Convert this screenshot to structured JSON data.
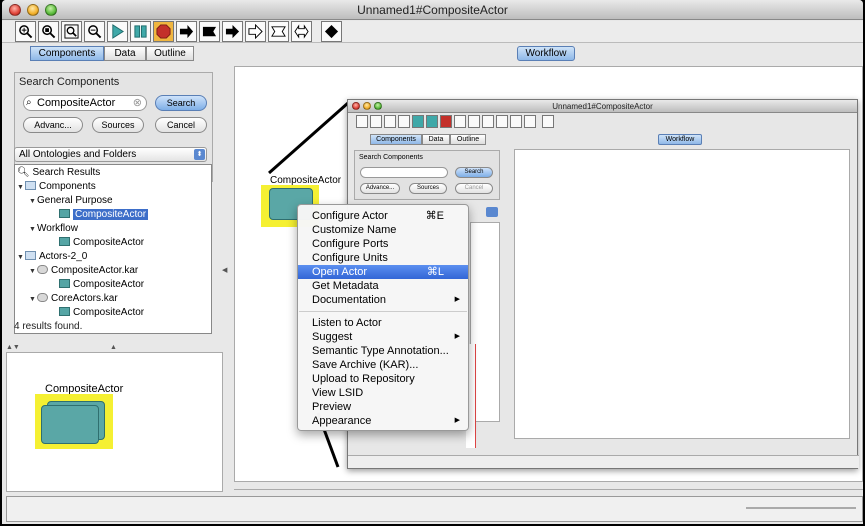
{
  "window": {
    "title": "Unnamed1#CompositeActor"
  },
  "toolbar": {
    "buttons": [
      "zoom-in-icon",
      "zoom-reset-icon",
      "zoom-fit-icon",
      "zoom-out-icon",
      "run-icon",
      "pause-icon",
      "stop-icon",
      "forward-arrow-icon",
      "flag-icon",
      "right-arrow-icon",
      "outline-arrow-icon",
      "outline-double-arrow-icon",
      "outline-bidirectional-arrow-icon",
      "diamond-icon"
    ]
  },
  "left_panel": {
    "tabs": [
      "Components",
      "Data",
      "Outline"
    ],
    "search_group_label": "Search Components",
    "search_value": "CompositeActor",
    "search_button": "Search",
    "advanced_button": "Advanc...",
    "sources_button": "Sources",
    "cancel_button": "Cancel",
    "ontology_select": "All Ontologies and Folders",
    "tree": [
      {
        "label": "Search Results",
        "level": 0
      },
      {
        "label": "Components",
        "level": 0
      },
      {
        "label": "General Purpose",
        "level": 1
      },
      {
        "label": "CompositeActor",
        "level": 2,
        "selected": true
      },
      {
        "label": "Workflow",
        "level": 1
      },
      {
        "label": "CompositeActor",
        "level": 2
      },
      {
        "label": "Actors-2_0",
        "level": 0
      },
      {
        "label": "CompositeActor.kar",
        "level": 1
      },
      {
        "label": "CompositeActor",
        "level": 2
      },
      {
        "label": "CoreActors.kar",
        "level": 1
      },
      {
        "label": "CompositeActor",
        "level": 2
      }
    ],
    "status": "4 results found."
  },
  "preview": {
    "actor_label": "CompositeActor"
  },
  "workflow_tab": "Workflow",
  "canvas": {
    "actor_label": "CompositeActor"
  },
  "inner_window": {
    "title": "Unnamed1#CompositeActor",
    "tabs": [
      "Components",
      "Data",
      "Outline"
    ],
    "search_group_label": "Search Components",
    "search_button": "Search",
    "advanced_button": "Advance...",
    "sources_button": "Sources",
    "cancel_button": "Cancel",
    "workflow_tab": "Workflow"
  },
  "context_menu": {
    "items": [
      {
        "label": "Configure Actor",
        "shortcut": "⌘E"
      },
      {
        "label": "Customize Name"
      },
      {
        "label": "Configure Ports"
      },
      {
        "label": "Configure Units"
      },
      {
        "label": "Open Actor",
        "shortcut": "⌘L",
        "highlighted": true
      },
      {
        "label": "Get Metadata"
      },
      {
        "label": "Documentation",
        "submenu": true
      },
      {
        "label": "Listen to Actor"
      },
      {
        "label": "Suggest",
        "submenu": true
      },
      {
        "label": "Semantic Type Annotation..."
      },
      {
        "label": "Save Archive (KAR)..."
      },
      {
        "label": "Upload to Repository"
      },
      {
        "label": "View LSID"
      },
      {
        "label": "Preview"
      },
      {
        "label": "Appearance",
        "submenu": true
      }
    ]
  },
  "colors": {
    "accent": "#3366d6",
    "actor_fill": "#5aa7a6",
    "actor_highlight": "#f5f032"
  }
}
